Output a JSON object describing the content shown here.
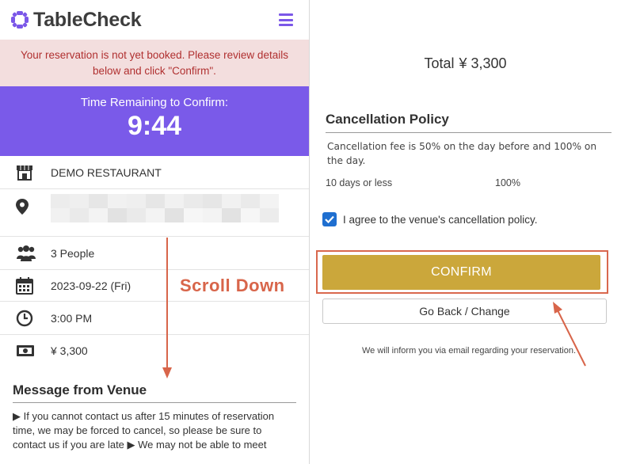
{
  "brand": {
    "name": "TableCheck"
  },
  "alert": {
    "text": "Your reservation is not yet booked. Please review details below and click \"Confirm\"."
  },
  "timer": {
    "label": "Time Remaining to Confirm:",
    "value": "9:44"
  },
  "details": {
    "restaurant": "DEMO RESTAURANT",
    "people": "3 People",
    "date": "2023-09-22 (Fri)",
    "time": "3:00 PM",
    "price": "¥ 3,300"
  },
  "message": {
    "title": "Message from Venue",
    "body": "▶ If you cannot contact us after 15 minutes of reservation time, we may be forced to cancel, so please be sure to contact us if you are late ▶ We may not be able to meet"
  },
  "annotation": {
    "scroll_text": "Scroll Down"
  },
  "summary": {
    "total_label": "Total",
    "total_value": "¥ 3,300"
  },
  "cancellation": {
    "title": "Cancellation Policy",
    "text": "Cancellation fee is 50% on the day before and 100% on the day.",
    "rows": [
      {
        "period": "10 days or less",
        "fee": "100%"
      }
    ]
  },
  "agreement": {
    "label": "I agree to the venue's cancellation policy.",
    "checked": true
  },
  "actions": {
    "confirm_label": "CONFIRM",
    "back_label": "Go Back / Change",
    "info_text": "We will inform you via email regarding your reservation."
  },
  "colors": {
    "accent_purple": "#7a5ae9",
    "confirm_gold": "#cba73b",
    "alert_bg": "#f3dede",
    "annotation_orange": "#d8654a"
  }
}
